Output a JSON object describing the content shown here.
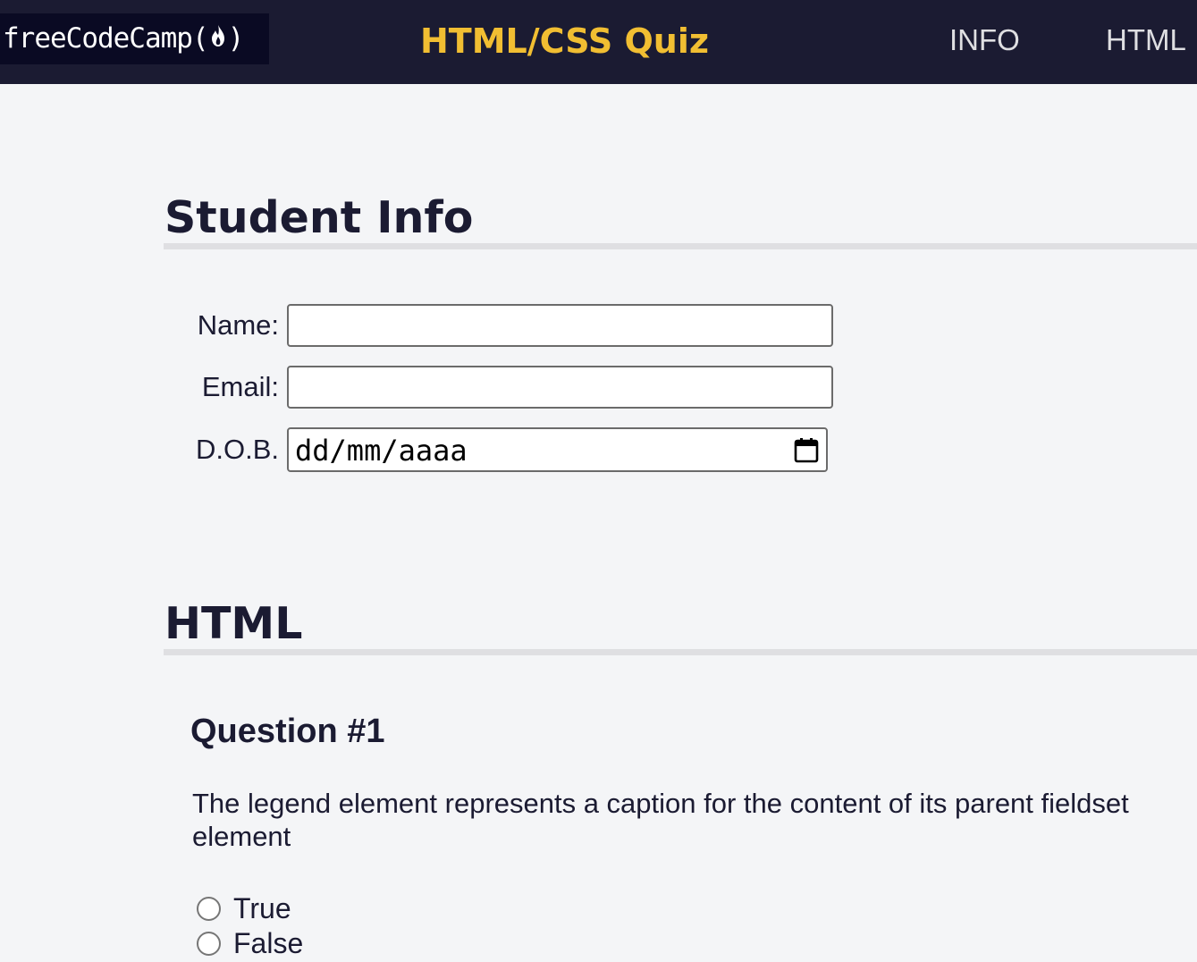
{
  "header": {
    "logo_text_before": "freeCodeCamp(",
    "logo_text_after": ")",
    "title": "HTML/CSS Quiz",
    "nav": [
      {
        "label": "INFO"
      },
      {
        "label": "HTML"
      }
    ]
  },
  "student_info": {
    "heading": "Student Info",
    "name_label": "Name:",
    "name_value": "",
    "email_label": "Email:",
    "email_value": "",
    "dob_label": "D.O.B.",
    "dob_value": "dd/mm/aaaa"
  },
  "html_section": {
    "heading": "HTML",
    "question": {
      "title": "Question #1",
      "text": "The legend element represents a caption for the content of its parent fieldset element",
      "options": [
        {
          "label": "True",
          "selected": false
        },
        {
          "label": "False",
          "selected": false
        }
      ]
    }
  },
  "colors": {
    "nav_background": "#1b1b32",
    "logo_background": "#0a0a23",
    "title_accent": "#f1be32",
    "page_background": "#f4f5f7",
    "rule": "#dfdfe2"
  },
  "icons": {
    "logo_flame": "flame-icon",
    "date_picker": "calendar-icon",
    "radio": "radio-button"
  }
}
